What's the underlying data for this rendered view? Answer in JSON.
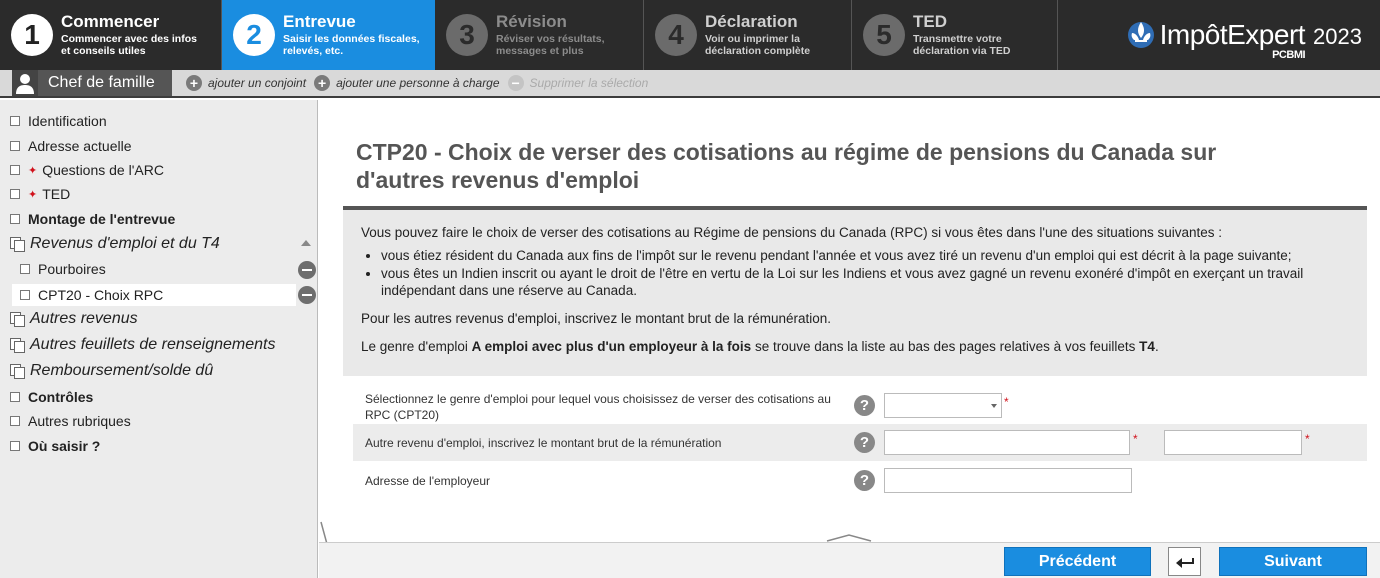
{
  "steps": [
    {
      "num": "1",
      "title": "Commencer",
      "sub1": "Commencer avec des infos",
      "sub2": "et conseils utiles"
    },
    {
      "num": "2",
      "title": "Entrevue",
      "sub1": "Saisir les données fiscales,",
      "sub2": "relevés, etc."
    },
    {
      "num": "3",
      "title": "Révision",
      "sub1": "Réviser vos résultats,",
      "sub2": "messages et plus"
    },
    {
      "num": "4",
      "title": "Déclaration",
      "sub1": "Voir ou imprimer la",
      "sub2": "déclaration complète"
    },
    {
      "num": "5",
      "title": "TED",
      "sub1": "Transmettre votre",
      "sub2": "déclaration via TED"
    }
  ],
  "brand": {
    "name": "ImpôtExpert",
    "sub": "PCBMI",
    "year": "2023"
  },
  "personbar": {
    "tab": "Chef de famille",
    "add_spouse": "ajouter un conjoint",
    "add_dependent": "ajouter une personne à charge",
    "delete_selection": "Supprimer la sélection"
  },
  "sidebar": {
    "items": [
      {
        "label": "Identification"
      },
      {
        "label": "Adresse actuelle"
      },
      {
        "label": "Questions de l'ARC"
      },
      {
        "label": "TED"
      },
      {
        "label": "Montage de l'entrevue"
      },
      {
        "label": "Revenus d'emploi et du T4"
      },
      {
        "label": "Pourboires"
      },
      {
        "label": "CPT20 - Choix RPC"
      },
      {
        "label": "Autres revenus"
      },
      {
        "label": "Autres feuillets de renseignements"
      },
      {
        "label": "Remboursement/solde dû"
      },
      {
        "label": "Contrôles"
      },
      {
        "label": "Autres rubriques"
      },
      {
        "label": "Où saisir ?"
      }
    ]
  },
  "main": {
    "title_line1": "CTP20 - Choix de verser des cotisations au régime de pensions du Canada sur",
    "title_line2": "d'autres revenus d'emploi",
    "intro": "Vous pouvez faire le choix de verser des cotisations au Régime de pensions du Canada (RPC) si vous êtes dans l'une des situations suivantes :",
    "bullet1": "vous étiez résident du Canada aux fins de l'impôt sur le revenu pendant l'année et vous avez tiré un revenu d'un emploi qui est décrit à la page suivante;",
    "bullet2": "vous êtes un Indien inscrit ou ayant le droit de l'être en vertu de la Loi sur les Indiens et vous avez gagné un revenu exonéré d'impôt en exerçant un travail indépendant dans une réserve au Canada.",
    "para2": "Pour les autres revenus d'emploi, inscrivez le montant brut de la rémunération.",
    "para3_a": "Le genre d'emploi ",
    "para3_b": "A emploi avec plus d'un employeur à la fois",
    "para3_c": " se trouve dans la liste au bas des pages relatives à vos feuillets ",
    "para3_d": "T4",
    "para3_e": "."
  },
  "form": {
    "row1_label": "Sélectionnez le genre d'emploi pour lequel vous choisissez de verser des cotisations au RPC (CPT20)",
    "row2_label": "Autre revenu d'emploi, inscrivez le montant brut de la rémunération",
    "row3_label": "Adresse de l'employeur",
    "help": "?",
    "required": "*",
    "row1_value": "",
    "row2_value_a": "",
    "row2_value_b": "",
    "row3_value": ""
  },
  "buttons": {
    "previous": "Précédent",
    "next": "Suivant"
  },
  "colors": {
    "accent": "#1a8de0",
    "topbar": "#2b2b2b",
    "required": "#d1121c"
  }
}
